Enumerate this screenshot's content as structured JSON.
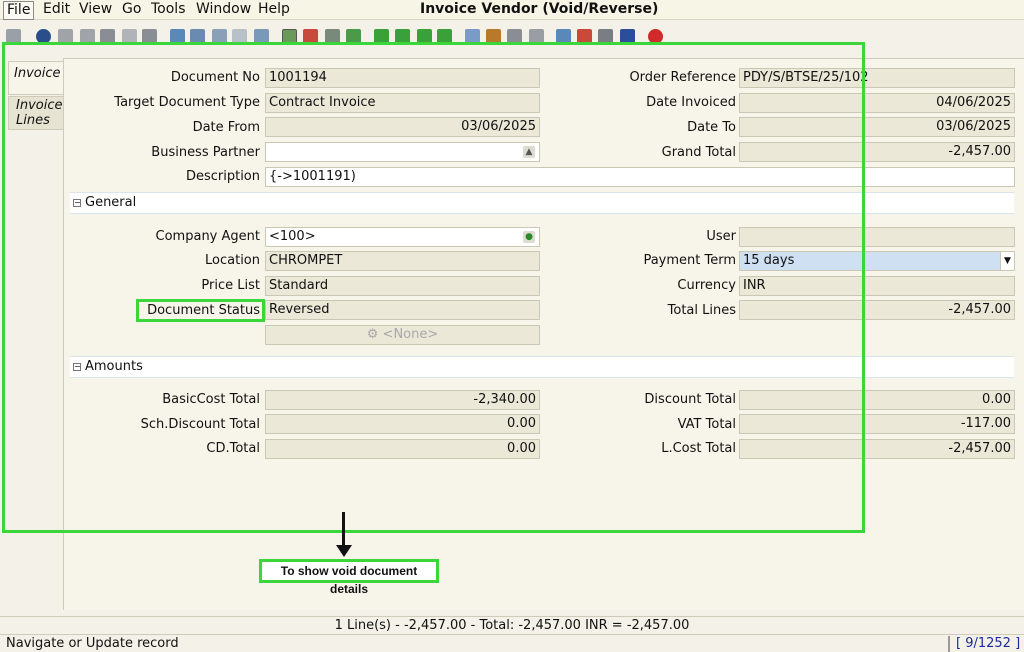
{
  "window": {
    "title": "Invoice Vendor (Void/Reverse)"
  },
  "menu": {
    "file": "File",
    "edit": "Edit",
    "view": "View",
    "go": "Go",
    "tools": "Tools",
    "window": "Window",
    "help": "Help"
  },
  "tabs": {
    "invoice": "Invoice",
    "invoice_lines_1": "Invoice",
    "invoice_lines_2": "Lines"
  },
  "header": {
    "document_no_label": "Document No",
    "document_no": "1001194",
    "target_doc_type_label": "Target Document Type",
    "target_doc_type": "Contract Invoice",
    "date_from_label": "Date From",
    "date_from": "03/06/2025",
    "business_partner_label": "Business Partner",
    "business_partner": "",
    "description_label": "Description",
    "description": "{->1001191)",
    "order_reference_label": "Order Reference",
    "order_reference": "PDY/S/BTSE/25/102",
    "date_invoiced_label": "Date Invoiced",
    "date_invoiced": "04/06/2025",
    "date_to_label": "Date To",
    "date_to": "03/06/2025",
    "grand_total_label": "Grand Total",
    "grand_total": "-2,457.00"
  },
  "general": {
    "section_label": "General",
    "company_agent_label": "Company Agent",
    "company_agent": "<100>",
    "location_label": "Location",
    "location": "CHROMPET",
    "price_list_label": "Price List",
    "price_list": "Standard",
    "document_status_label": "Document Status",
    "document_status": "Reversed",
    "none_button": "<None>",
    "user_label": "User",
    "user": "",
    "payment_term_label": "Payment Term",
    "payment_term": "15 days",
    "currency_label": "Currency",
    "currency": "INR",
    "total_lines_label": "Total Lines",
    "total_lines": "-2,457.00"
  },
  "amounts": {
    "section_label": "Amounts",
    "basic_cost_total_label": "BasicCost Total",
    "basic_cost_total": "-2,340.00",
    "sch_discount_total_label": "Sch.Discount Total",
    "sch_discount_total": "0.00",
    "cd_total_label": "CD.Total",
    "cd_total": "0.00",
    "discount_total_label": "Discount Total",
    "discount_total": "0.00",
    "vat_total_label": "VAT Total",
    "vat_total": "-117.00",
    "l_cost_total_label": "L.Cost Total",
    "l_cost_total": "-2,457.00"
  },
  "annotation": {
    "callout": "To show void document details"
  },
  "summary": {
    "text": "1 Line(s) - -2,457.00 -  Total: -2,457.00  INR  =  -2,457.00"
  },
  "status": {
    "message": "Navigate or Update record",
    "record_count": "[ 9/1252 ]"
  }
}
